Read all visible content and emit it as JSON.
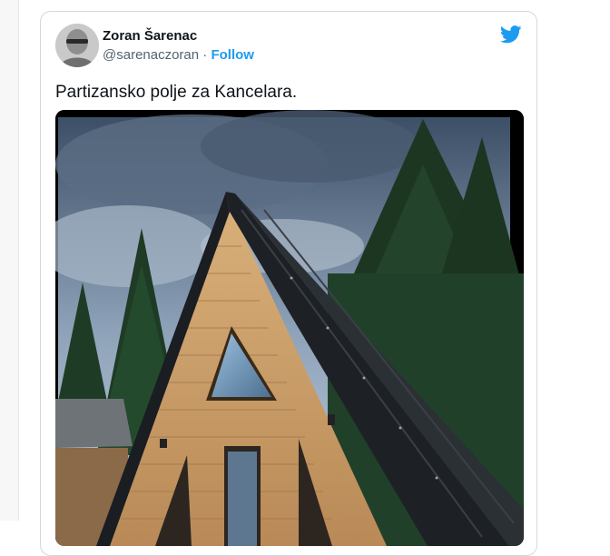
{
  "tweet": {
    "author": {
      "display_name": "Zoran Šarenac",
      "handle": "@sarenaczoran",
      "separator": " · ",
      "follow_label": "Follow"
    },
    "text": "Partizansko polje za Kancelara.",
    "brand_icon": "twitter-bird-icon",
    "media": {
      "description_icon": "a-frame-cabin-photo"
    }
  },
  "colors": {
    "accent": "#1d9bf0",
    "text_primary": "#0f1419",
    "text_secondary": "#536471",
    "border": "#cfd9de"
  }
}
